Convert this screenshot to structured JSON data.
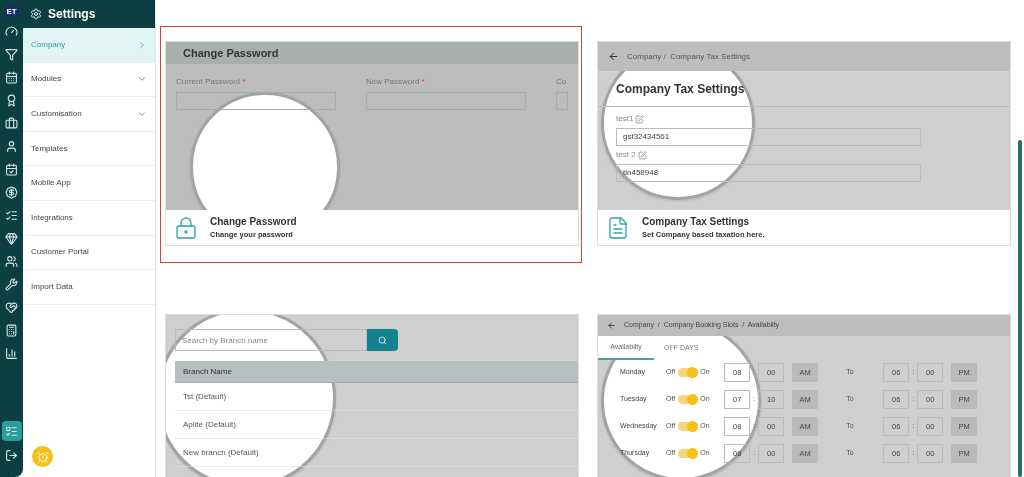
{
  "rail": {
    "logo": "ET",
    "items": [
      {
        "kind": "gauge",
        "selected": false
      },
      {
        "kind": "funnel",
        "selected": false
      },
      {
        "kind": "calendar",
        "selected": false
      },
      {
        "kind": "badge",
        "selected": false
      },
      {
        "kind": "briefcase",
        "selected": false
      },
      {
        "kind": "user",
        "selected": false
      },
      {
        "kind": "calendar-box",
        "selected": false
      },
      {
        "kind": "dollar",
        "selected": false
      },
      {
        "kind": "list",
        "selected": false
      },
      {
        "kind": "gem",
        "selected": false
      },
      {
        "kind": "users",
        "selected": false
      },
      {
        "kind": "tools",
        "selected": false
      },
      {
        "kind": "hands",
        "selected": false
      },
      {
        "kind": "calculator",
        "selected": false
      },
      {
        "kind": "chart",
        "selected": false
      }
    ],
    "bottom": [
      {
        "kind": "settings-list",
        "selected": true
      },
      {
        "kind": "logout",
        "selected": false
      }
    ]
  },
  "sidebar": {
    "title": "Settings",
    "items": [
      {
        "label": "Company",
        "selected": true,
        "kind": "arrow"
      },
      {
        "label": "Modules",
        "selected": false,
        "kind": "caret"
      },
      {
        "label": "Customisation",
        "selected": false,
        "kind": "caret"
      },
      {
        "label": "Templates",
        "selected": false,
        "kind": "plain"
      },
      {
        "label": "Mobile App",
        "selected": false,
        "kind": "plain"
      },
      {
        "label": "Integrations",
        "selected": false,
        "kind": "plain"
      },
      {
        "label": "Customer Portal",
        "selected": false,
        "kind": "plain"
      },
      {
        "label": "Import Data",
        "selected": false,
        "kind": "plain"
      }
    ]
  },
  "cards": [
    {
      "kind": "password",
      "selected": true,
      "preview": {
        "heading": "Change Password",
        "fields": [
          {
            "label": "Current Password",
            "required": "*"
          },
          {
            "label": "New Password",
            "required": "*"
          },
          {
            "label": "Co"
          }
        ]
      },
      "title": "Change Password",
      "subtitle": "Change your password"
    },
    {
      "kind": "tax",
      "selected": false,
      "preview": {
        "breadcrumb": "Company /  Company Tax Settings",
        "heading": "Company Tax Settings",
        "fields": [
          {
            "label": "test1",
            "value": "gst32434561"
          },
          {
            "label": "test 2",
            "value": "tin458948"
          }
        ]
      },
      "title": "Company Tax Settings",
      "subtitle": "Set Company based taxation here."
    },
    {
      "kind": "branches",
      "selected": false,
      "preview": {
        "placeholder": "Search by Branch name",
        "column": "Branch Name",
        "rows": [
          "Tst (Default)",
          "Aplite (Default)",
          "New branch (Default)"
        ]
      }
    },
    {
      "kind": "availability",
      "selected": false,
      "preview": {
        "breadcrumb": "Company  /  Company Booking Slots  /  Availabilty",
        "tabs": [
          {
            "label": "Availabilty",
            "selected": true
          },
          {
            "label": "OFF DAYS",
            "selected": false
          }
        ],
        "rows": [
          {
            "day": "Monday",
            "off": "Off",
            "on": "On",
            "enabled": true,
            "from": {
              "hour": "08",
              "sep": ":",
              "minute": "00",
              "period": "AM"
            },
            "to_label": "To",
            "to": {
              "hour": "06",
              "sep": ":",
              "minute": "00",
              "period": "PM"
            }
          },
          {
            "day": "Tuesday",
            "off": "Off",
            "on": "On",
            "enabled": true,
            "from": {
              "hour": "07",
              "sep": ":",
              "minute": "10",
              "period": "AM"
            },
            "to_label": "To",
            "to": {
              "hour": "06",
              "sep": ":",
              "minute": "00",
              "period": "PM"
            }
          },
          {
            "day": "Wednesday",
            "off": "Off",
            "on": "On",
            "enabled": true,
            "from": {
              "hour": "08",
              "sep": ":",
              "minute": "00",
              "period": "AM"
            },
            "to_label": "To",
            "to": {
              "hour": "06",
              "sep": ":",
              "minute": "00",
              "period": "PM"
            }
          },
          {
            "day": "Thursday",
            "off": "Off",
            "on": "On",
            "enabled": true,
            "from": {
              "hour": "08",
              "sep": ":",
              "minute": "00",
              "period": "AM"
            },
            "to_label": "To",
            "to": {
              "hour": "06",
              "sep": ":",
              "minute": "00",
              "period": "PM"
            }
          }
        ]
      }
    }
  ]
}
